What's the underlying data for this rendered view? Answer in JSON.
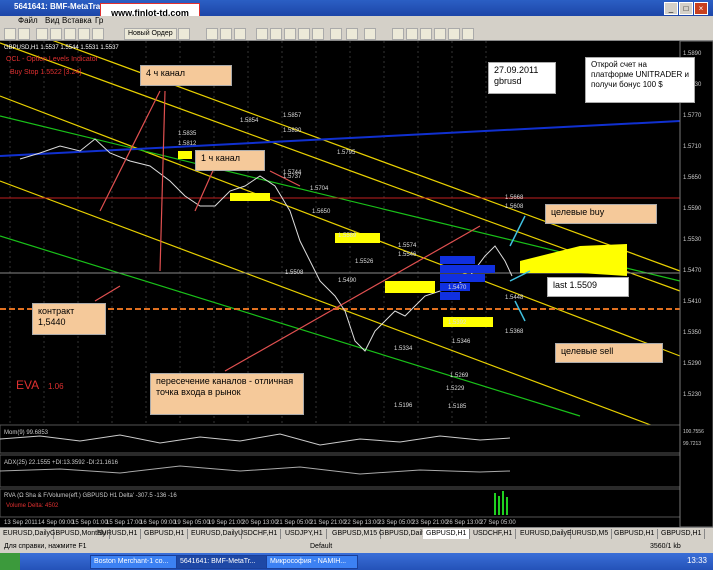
{
  "window": {
    "title": "5641641: BMF-MetaTrader",
    "url_overlay": "www.finlot-td.com",
    "minimize": "_",
    "maximize": "□",
    "close": "×"
  },
  "menu": [
    "Файл",
    "Вид",
    "Вставка",
    "Гр"
  ],
  "toolbar": {
    "new_order": "Новый Ордер"
  },
  "chart": {
    "symbol_header": "GBPUSD,H1  1.5537 1.5544 1.5531 1.5537",
    "label_date": "27.09.2011",
    "label_symbol": "gbrusd",
    "promo": "Открой счет на платформе UNITRADER и получи бонус 100 $",
    "ann_4h": "4 ч канал",
    "ann_1h": "1 ч канал",
    "ann_contract": "контракт 1,5440",
    "ann_cross": "пересечение каналов - отличная точка входа в рынок",
    "ann_buy": "целевые buy",
    "ann_last": "last 1.5509",
    "ann_sell": "целевые sell",
    "eva": "EVA",
    "eva_value": "1.06",
    "top_red_1": "OCL - Option Levels Indicator",
    "top_red_2": "Buy Stop 1.5522 [3.24]",
    "ind_1": "Mom(9) 99.6853",
    "ind_2": "ADX(25) 22.1555 +DI:13.3592 -DI:21.1616",
    "ind_3": "RVA (Ω Sha & F/Volume(eff.) GBPUSD H1 Delta'  -307.5  -136  -16",
    "ind_4": "Volume Delta: 4502",
    "price_labels": [
      "1.5890",
      "1.5830",
      "1.5770",
      "1.5710",
      "1.5650",
      "1.5590",
      "1.5530",
      "1.5470",
      "1.5410",
      "1.5350",
      "1.5290",
      "1.5230"
    ],
    "osc_labels": [
      "100.7556",
      "99.7213"
    ],
    "level_labels": [
      "1.5857",
      "1.5854",
      "1.5835",
      "1.5830",
      "1.5812",
      "1.5795",
      "1.5744",
      "1.5737",
      "1.5704",
      "1.5650",
      "1.5589",
      "1.5574",
      "1.5546",
      "1.5526",
      "1.5508",
      "1.5490",
      "1.5470",
      "1.5448",
      "1.5392",
      "1.5368",
      "1.5346",
      "1.5334",
      "1.5269",
      "1.5229",
      "1.5196",
      "1.5185",
      "1.5668",
      "1.5608"
    ],
    "date_labels": [
      "13 Sep 2011",
      "14 Sep 09:00",
      "15 Sep 01:00",
      "15 Sep 17:00",
      "16 Sep 09:00",
      "19 Sep 05:00",
      "19 Sep 21:00",
      "20 Sep 13:00",
      "21 Sep 05:00",
      "21 Sep 21:00",
      "22 Sep 13:00",
      "23 Sep 05:00",
      "23 Sep 21:00",
      "26 Sep 13:00",
      "27 Sep 05:00"
    ]
  },
  "tabs": [
    "EURUSD,Daily",
    "GBPUSD,Monthly",
    "EURUSD,H1",
    "GBPUSD,H1",
    "EURUSD,Daily",
    "USDCHF,H1",
    "USDJPY,H1",
    "GBPUSD,M15",
    "GBPUSD,Daily",
    "GBPUSD,H1",
    "USDCHF,H1",
    "EURUSD,Daily",
    "EURUSD,M5",
    "GBPUSD,H1",
    "GBPUSD,H1"
  ],
  "status": {
    "help": "Для справки, нажмите F1",
    "profile": "Default",
    "traffic": "3560/1 kb"
  },
  "taskbar": {
    "items": [
      "Boston Merchant-1 co...",
      "5641641: BMF-MetaTr...",
      "Микрософия - NAMIH..."
    ],
    "clock": "13:33"
  },
  "colors": {
    "accent_orange": "#f5c99a",
    "channel_yellow": "#e8d000",
    "channel_green": "#19c019",
    "channel_blue": "#1030d0",
    "level_red": "#d02020"
  }
}
